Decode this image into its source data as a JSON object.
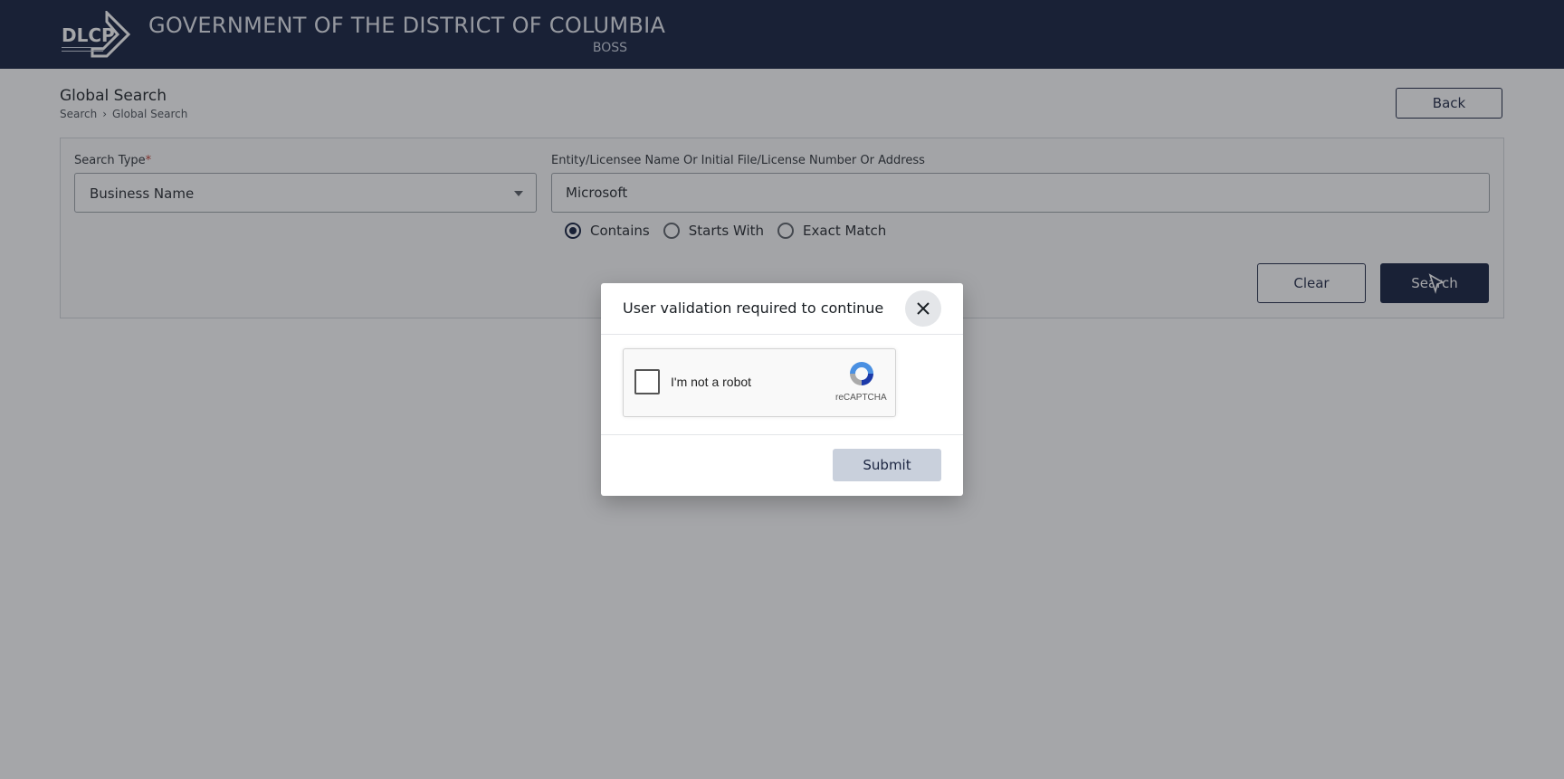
{
  "header": {
    "logo_text": "DLCP",
    "title": "GOVERNMENT OF THE DISTRICT OF COLUMBIA",
    "subtitle": "BOSS"
  },
  "page": {
    "title": "Global Search",
    "breadcrumb": [
      "Search",
      "Global Search"
    ],
    "breadcrumb_separator": "›",
    "back_label": "Back"
  },
  "form": {
    "search_type_label": "Search Type",
    "required_mark": "*",
    "search_type_value": "Business Name",
    "query_label": "Entity/Licensee Name Or Initial File/License Number Or Address",
    "query_value": "Microsoft",
    "match_options": [
      {
        "label": "Contains",
        "selected": true
      },
      {
        "label": "Starts With",
        "selected": false
      },
      {
        "label": "Exact Match",
        "selected": false
      }
    ],
    "clear_label": "Clear",
    "search_label": "Search"
  },
  "modal": {
    "title": "User validation required to continue",
    "captcha_label": "I'm not a robot",
    "captcha_brand": "reCAPTCHA",
    "submit_label": "Submit"
  },
  "colors": {
    "header_bg": "#0f1a3a",
    "primary": "#0f1a3a",
    "submit_bg": "#c9d0dc",
    "required": "#c0392b"
  }
}
